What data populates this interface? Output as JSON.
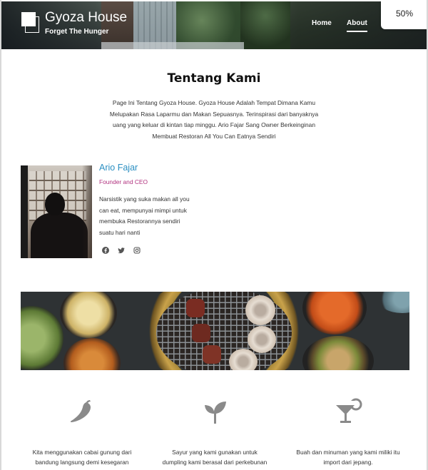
{
  "header": {
    "brand": "Gyoza House",
    "tagline": "Forget The Hunger",
    "nav": [
      {
        "label": "Home",
        "active": false
      },
      {
        "label": "About",
        "active": true
      }
    ]
  },
  "browser": {
    "zoom_label": "50%"
  },
  "about": {
    "title": "Tentang Kami",
    "intro_lines": [
      "Page Ini Tentang Gyoza House. Gyoza House Adalah Tempat Dimana Kamu",
      "Melupakan Rasa Laparmu dan Makan Sepuasnya. Terinspirasi dari banyaknya",
      "uang yang keluar di kintan tiap minggu. Ario Fajar Sang Owner Berkeinginan",
      "Membuat Restoran All You Can Eatnya Sendiri"
    ]
  },
  "profile": {
    "name": "Ario Fajar",
    "role": "Founder and CEO",
    "bio_lines": [
      "Narsistik yang suka makan all you",
      "can eat, mempunyai mimpi untuk",
      "membuka Restorannya sendiri",
      "suatu hari nanti"
    ],
    "socials": [
      "facebook-icon",
      "twitter-icon",
      "instagram-icon"
    ]
  },
  "features": [
    {
      "icon": "chili-pepper-icon",
      "lines": [
        "Kita menggunakan cabai gunung dari",
        "bandung langsung demi kesegaran"
      ]
    },
    {
      "icon": "sprout-icon",
      "lines": [
        "Sayur yang kami gunakan untuk",
        "dumpling kami berasal dari perkebunan"
      ]
    },
    {
      "icon": "cocktail-icon",
      "lines": [
        "Buah dan minuman yang kami miliki itu",
        "import dari jepang."
      ]
    }
  ],
  "colors": {
    "name_blue": "#2b8fc2",
    "role_magenta": "#b0317e",
    "icon_gray": "#8a8a8a"
  }
}
